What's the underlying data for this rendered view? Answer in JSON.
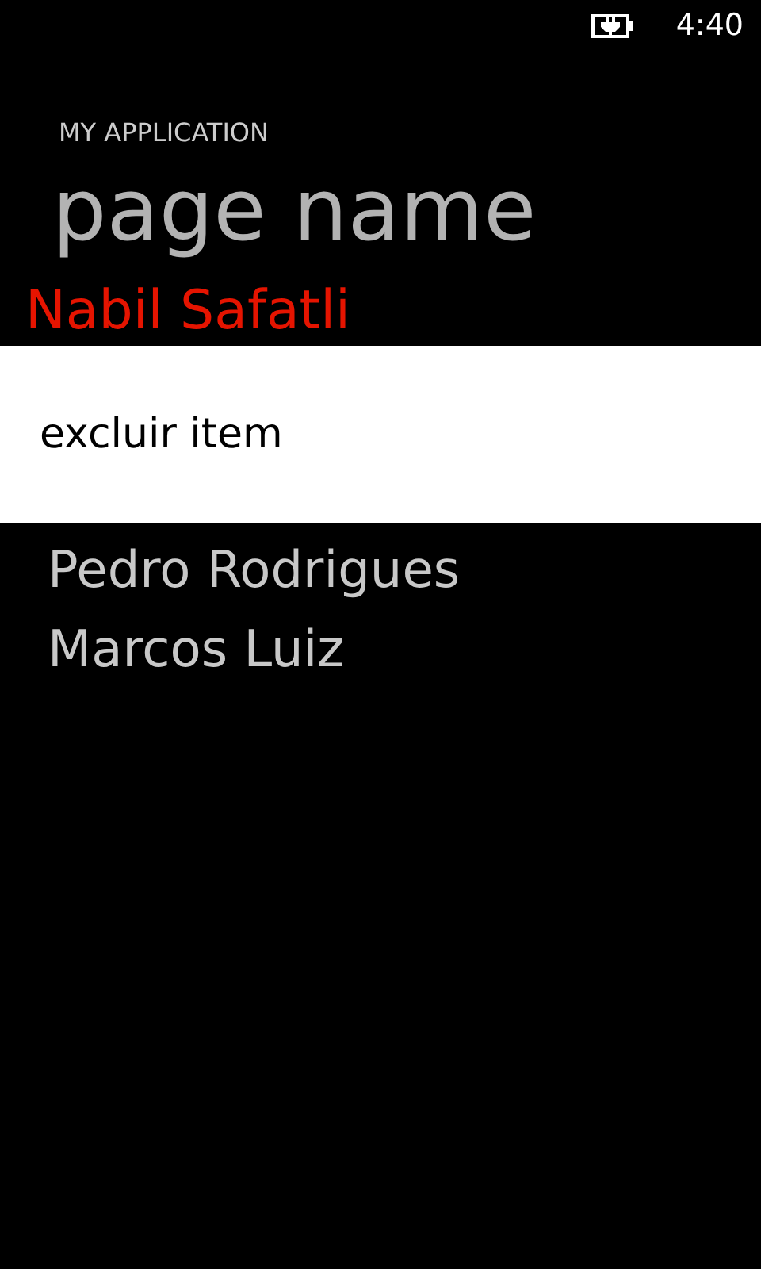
{
  "status_bar": {
    "time": "4:40"
  },
  "app_title": "MY APPLICATION",
  "page_title": "page name",
  "items": [
    {
      "name": "Nabil Safatli",
      "selected": true
    },
    {
      "name": "Pedro Rodrigues",
      "selected": false
    },
    {
      "name": "Marcos Luiz",
      "selected": false
    }
  ],
  "context_menu": {
    "items": [
      "excluir item"
    ]
  }
}
